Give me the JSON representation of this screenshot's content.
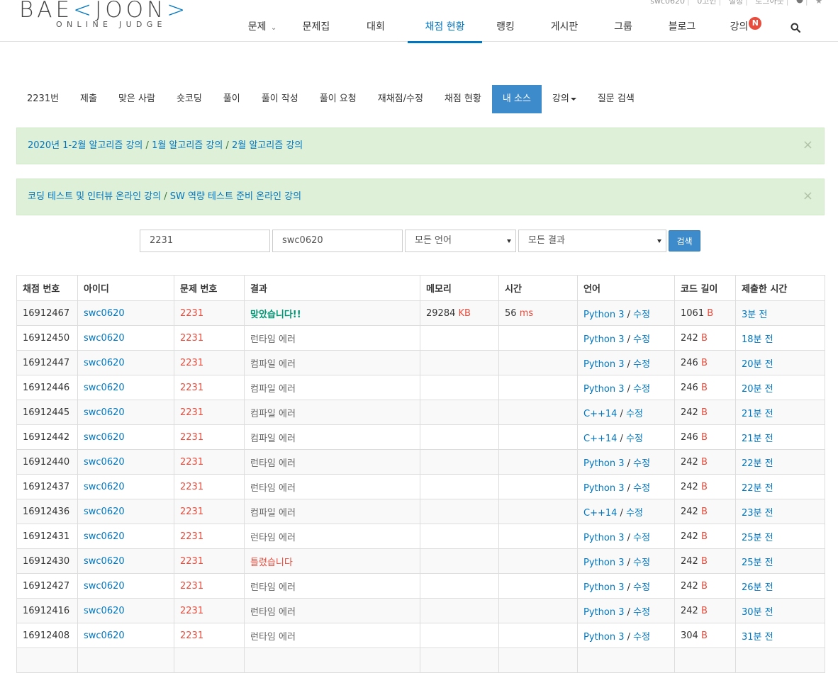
{
  "userbar": {
    "items": [
      "swc0620",
      "0고인",
      "설정",
      "로그아웃"
    ]
  },
  "logo": {
    "main_a": "BAE",
    "main_b": "JOON",
    "sub": "ONLINE JUDGE"
  },
  "nav": {
    "items": [
      "문제",
      "문제집",
      "대회",
      "채점 현황",
      "랭킹",
      "게시판",
      "그룹",
      "블로그",
      "강의"
    ],
    "badge": "N",
    "active_index": 3
  },
  "tabs": {
    "items": [
      "2231번",
      "제출",
      "맞은 사람",
      "숏코딩",
      "풀이",
      "풀이 작성",
      "풀이 요청",
      "재채점/수정",
      "채점 현황",
      "내 소스",
      "강의",
      "질문 검색"
    ],
    "active_index": 9
  },
  "alerts": [
    {
      "link1": "2020년 1-2월 알고리즘 강의",
      "sep1": " / ",
      "link2": "1월 알고리즘 강의",
      "sep2": " / ",
      "link3": "2월 알고리즘 강의"
    },
    {
      "link1": "코딩 테스트 및 인터뷰 온라인 강의",
      "sep1": " / ",
      "link2": "SW 역량 테스트 준비 온라인 강의"
    }
  ],
  "close_glyph": "×",
  "search": {
    "problem_id": "2231",
    "user_id": "swc0620",
    "language": "모든 언어",
    "result": "모든 결과",
    "button": "검색"
  },
  "table": {
    "headers": [
      "채점 번호",
      "아이디",
      "문제 번호",
      "결과",
      "메모리",
      "시간",
      "언어",
      "코드 길이",
      "제출한 시간"
    ],
    "rows": [
      {
        "id": "16912467",
        "user": "swc0620",
        "problem": "2231",
        "result": "맞았습니다!!",
        "result_type": "ac",
        "memory": "29284",
        "memory_unit": "KB",
        "time": "56",
        "time_unit": "ms",
        "lang": "Python 3",
        "edit": "수정",
        "len": "1061",
        "len_unit": "B",
        "ago_num": "3",
        "ago_text": "분 전"
      },
      {
        "id": "16912450",
        "user": "swc0620",
        "problem": "2231",
        "result": "런타임 에러",
        "result_type": "err",
        "memory": "",
        "memory_unit": "",
        "time": "",
        "time_unit": "",
        "lang": "Python 3",
        "edit": "수정",
        "len": "242",
        "len_unit": "B",
        "ago_num": "18",
        "ago_text": "분 전"
      },
      {
        "id": "16912447",
        "user": "swc0620",
        "problem": "2231",
        "result": "컴파일 에러",
        "result_type": "err",
        "memory": "",
        "memory_unit": "",
        "time": "",
        "time_unit": "",
        "lang": "Python 3",
        "edit": "수정",
        "len": "246",
        "len_unit": "B",
        "ago_num": "20",
        "ago_text": "분 전"
      },
      {
        "id": "16912446",
        "user": "swc0620",
        "problem": "2231",
        "result": "컴파일 에러",
        "result_type": "err",
        "memory": "",
        "memory_unit": "",
        "time": "",
        "time_unit": "",
        "lang": "Python 3",
        "edit": "수정",
        "len": "246",
        "len_unit": "B",
        "ago_num": "20",
        "ago_text": "분 전"
      },
      {
        "id": "16912445",
        "user": "swc0620",
        "problem": "2231",
        "result": "컴파일 에러",
        "result_type": "err",
        "memory": "",
        "memory_unit": "",
        "time": "",
        "time_unit": "",
        "lang": "C++14",
        "edit": "수정",
        "len": "242",
        "len_unit": "B",
        "ago_num": "21",
        "ago_text": "분 전"
      },
      {
        "id": "16912442",
        "user": "swc0620",
        "problem": "2231",
        "result": "컴파일 에러",
        "result_type": "err",
        "memory": "",
        "memory_unit": "",
        "time": "",
        "time_unit": "",
        "lang": "C++14",
        "edit": "수정",
        "len": "246",
        "len_unit": "B",
        "ago_num": "21",
        "ago_text": "분 전"
      },
      {
        "id": "16912440",
        "user": "swc0620",
        "problem": "2231",
        "result": "런타임 에러",
        "result_type": "err",
        "memory": "",
        "memory_unit": "",
        "time": "",
        "time_unit": "",
        "lang": "Python 3",
        "edit": "수정",
        "len": "242",
        "len_unit": "B",
        "ago_num": "22",
        "ago_text": "분 전"
      },
      {
        "id": "16912437",
        "user": "swc0620",
        "problem": "2231",
        "result": "런타임 에러",
        "result_type": "err",
        "memory": "",
        "memory_unit": "",
        "time": "",
        "time_unit": "",
        "lang": "Python 3",
        "edit": "수정",
        "len": "242",
        "len_unit": "B",
        "ago_num": "22",
        "ago_text": "분 전"
      },
      {
        "id": "16912436",
        "user": "swc0620",
        "problem": "2231",
        "result": "컴파일 에러",
        "result_type": "err",
        "memory": "",
        "memory_unit": "",
        "time": "",
        "time_unit": "",
        "lang": "C++14",
        "edit": "수정",
        "len": "242",
        "len_unit": "B",
        "ago_num": "23",
        "ago_text": "분 전"
      },
      {
        "id": "16912431",
        "user": "swc0620",
        "problem": "2231",
        "result": "런타임 에러",
        "result_type": "err",
        "memory": "",
        "memory_unit": "",
        "time": "",
        "time_unit": "",
        "lang": "Python 3",
        "edit": "수정",
        "len": "242",
        "len_unit": "B",
        "ago_num": "25",
        "ago_text": "분 전"
      },
      {
        "id": "16912430",
        "user": "swc0620",
        "problem": "2231",
        "result": "틀렸습니다",
        "result_type": "wa",
        "memory": "",
        "memory_unit": "",
        "time": "",
        "time_unit": "",
        "lang": "Python 3",
        "edit": "수정",
        "len": "242",
        "len_unit": "B",
        "ago_num": "25",
        "ago_text": "분 전"
      },
      {
        "id": "16912427",
        "user": "swc0620",
        "problem": "2231",
        "result": "런타임 에러",
        "result_type": "err",
        "memory": "",
        "memory_unit": "",
        "time": "",
        "time_unit": "",
        "lang": "Python 3",
        "edit": "수정",
        "len": "242",
        "len_unit": "B",
        "ago_num": "26",
        "ago_text": "분 전"
      },
      {
        "id": "16912416",
        "user": "swc0620",
        "problem": "2231",
        "result": "런타임 에러",
        "result_type": "err",
        "memory": "",
        "memory_unit": "",
        "time": "",
        "time_unit": "",
        "lang": "Python 3",
        "edit": "수정",
        "len": "242",
        "len_unit": "B",
        "ago_num": "30",
        "ago_text": "분 전"
      },
      {
        "id": "16912408",
        "user": "swc0620",
        "problem": "2231",
        "result": "런타임 에러",
        "result_type": "err",
        "memory": "",
        "memory_unit": "",
        "time": "",
        "time_unit": "",
        "lang": "Python 3",
        "edit": "수정",
        "len": "304",
        "len_unit": "B",
        "ago_num": "31",
        "ago_text": "분 전"
      }
    ]
  },
  "colors": {
    "brand": "#0076c0",
    "active_tab": "#3d8bcb",
    "accepted": "#009874",
    "wrong": "#e74c3c",
    "alert_bg": "#dff0d8",
    "badge": "#e74c3c"
  }
}
